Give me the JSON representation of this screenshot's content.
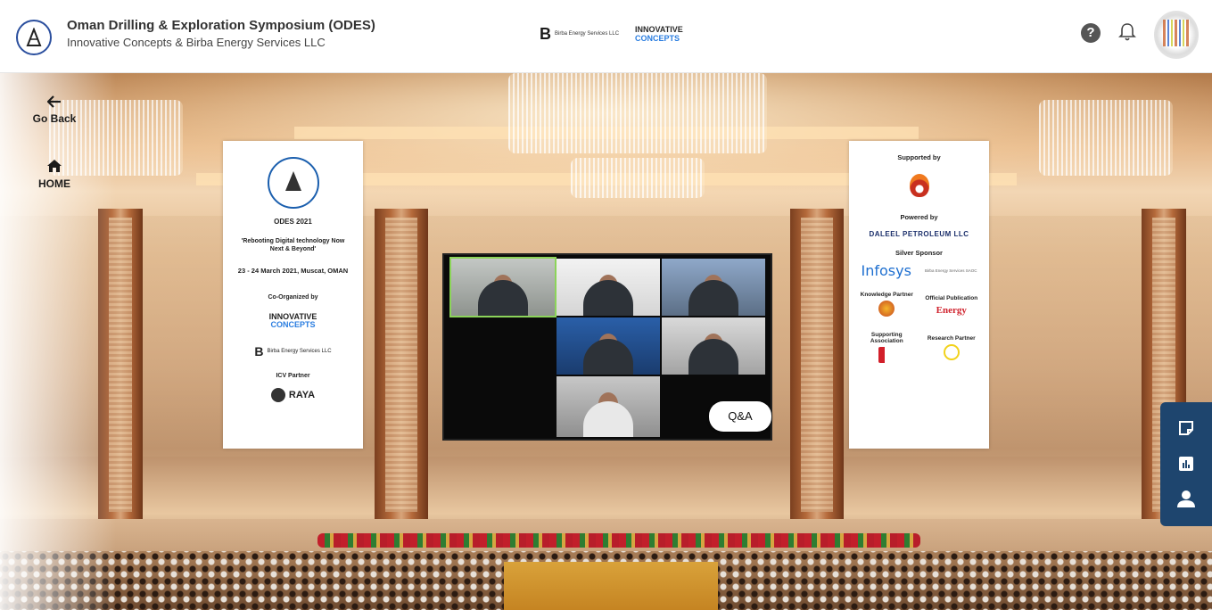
{
  "header": {
    "title": "Oman Drilling & Exploration Symposium (ODES)",
    "subtitle": "Innovative Concepts & Birba Energy Services LLC",
    "center_logos": {
      "birba_mark": "B",
      "birba_text": "Birba Energy Services LLC",
      "inno_line1": "INNOVATIVE",
      "inno_line2": "CONCEPTS"
    },
    "icons": [
      "help-icon",
      "bell-icon",
      "avatar"
    ]
  },
  "nav": {
    "back_label": "Go Back",
    "home_label": "HOME"
  },
  "left_banner": {
    "year": "ODES 2021",
    "theme": "'Rebooting Digital technology Now Next & Beyond'",
    "date": "23 - 24 March 2021, Muscat, OMAN",
    "co_organized": "Co-Organized by",
    "inno_line1": "INNOVATIVE",
    "inno_line2": "CONCEPTS",
    "birba": "Birba Energy Services LLC",
    "icv": "ICV Partner",
    "raya": "RAYA"
  },
  "right_banner": {
    "supported": "Supported by",
    "powered": "Powered by",
    "daleel": "DALEEL PETROLEUM LLC",
    "silver": "Silver Sponsor",
    "infosys": "Infosys",
    "birba_small": "Birba Energy Services SAOC",
    "knowledge": "Knowledge Partner",
    "official": "Official Publication",
    "energy": "Energy",
    "supporting": "Supporting Association",
    "research": "Research Partner"
  },
  "qa_button": "Q&A",
  "side_tools": [
    "notes-icon",
    "chart-icon",
    "user-icon"
  ],
  "colors": {
    "toolbar": "#1e456e",
    "active_tile": "#8cd45a"
  }
}
